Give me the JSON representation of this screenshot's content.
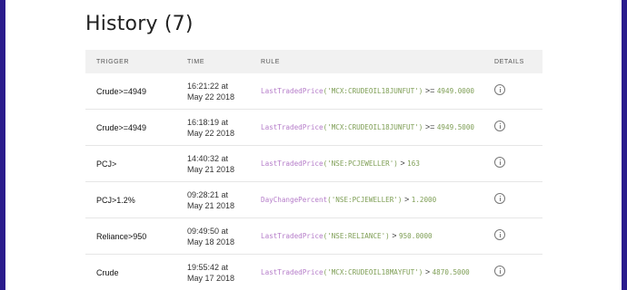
{
  "page": {
    "title": "History (7)"
  },
  "table": {
    "columns": [
      "TRIGGER",
      "TIME",
      "RULE",
      "DETAILS"
    ],
    "rows": [
      {
        "trigger": "Crude>=4949",
        "time_line1": "16:21:22 at",
        "time_line2": "May 22 2018",
        "rule_fn": "LastTradedPrice",
        "rule_arg": "('MCX:CRUDEOIL18JUNFUT')",
        "rule_op": ">=",
        "rule_value": "4949.0000"
      },
      {
        "trigger": "Crude>=4949",
        "time_line1": "16:18:19 at",
        "time_line2": "May 22 2018",
        "rule_fn": "LastTradedPrice",
        "rule_arg": "('MCX:CRUDEOIL18JUNFUT')",
        "rule_op": ">=",
        "rule_value": "4949.5000"
      },
      {
        "trigger": "PCJ>",
        "time_line1": "14:40:32 at",
        "time_line2": "May 21 2018",
        "rule_fn": "LastTradedPrice",
        "rule_arg": "('NSE:PCJEWELLER')",
        "rule_op": ">",
        "rule_value": "163"
      },
      {
        "trigger": "PCJ>1.2%",
        "time_line1": "09:28:21 at",
        "time_line2": "May 21 2018",
        "rule_fn": "DayChangePercent",
        "rule_arg": "('NSE:PCJEWELLER')",
        "rule_op": ">",
        "rule_value": "1.2000"
      },
      {
        "trigger": "Reliance>950",
        "time_line1": "09:49:50 at",
        "time_line2": "May 18 2018",
        "rule_fn": "LastTradedPrice",
        "rule_arg": "('NSE:RELIANCE')",
        "rule_op": ">",
        "rule_value": "950.0000"
      },
      {
        "trigger": "Crude",
        "time_line1": "19:55:42 at",
        "time_line2": "May 17 2018",
        "rule_fn": "LastTradedPrice",
        "rule_arg": "('MCX:CRUDEOIL18MAYFUT')",
        "rule_op": ">",
        "rule_value": "4870.5000"
      }
    ]
  },
  "icons": {
    "details": "info-circle-icon"
  },
  "colors": {
    "frame_border": "#2a1c8c",
    "header_bg": "#f1f1f1",
    "rule_function": "#b57cc9",
    "rule_string": "#7e9e55"
  }
}
